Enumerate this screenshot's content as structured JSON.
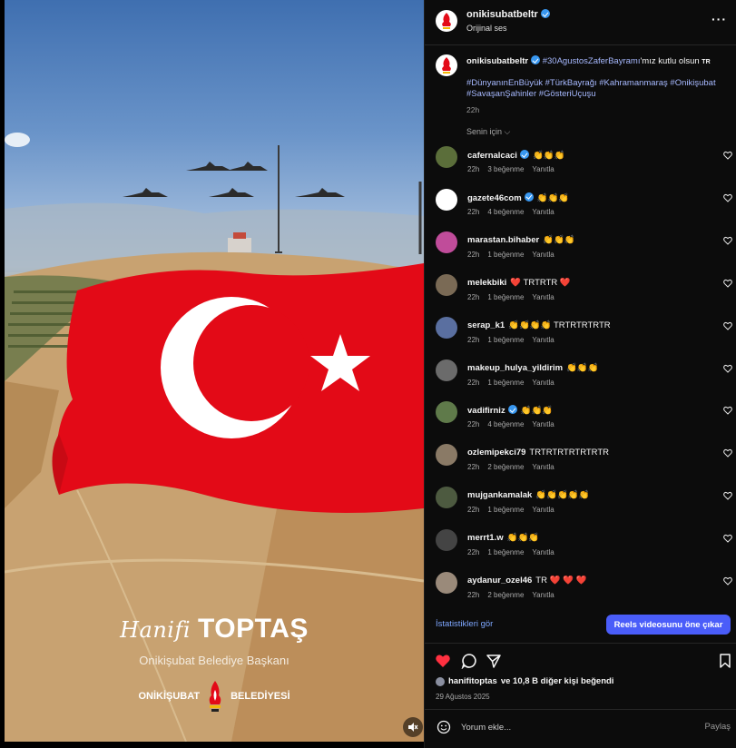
{
  "video": {
    "brand_script": "Hanifi",
    "brand_bold": "TOPTAŞ",
    "brand_title": "Onikişubat Belediye Başkanı",
    "muni_left": "ONİKİŞUBAT",
    "muni_right": "BELEDİYESİ",
    "mute_icon": "speaker-muted-icon"
  },
  "header": {
    "username": "onikisubatbeltr",
    "audio": "Orijinal ses",
    "more_icon": "more-icon"
  },
  "caption": {
    "username": "onikisubatbeltr",
    "hashtag1": "#30AgustosZaferBayramı",
    "text1": "'mız kutlu olsun",
    "flag_text": "TR",
    "tags_line1": "#DünyanınEnBüyük #TürkBayrağı #Kahramanmaraş #Onikişubat",
    "tags_line2": "#SavaşanŞahinler #GösteriUçuşu",
    "time": "22h"
  },
  "filter_label": "Senin için",
  "comments": [
    {
      "user": "cafernalcaci",
      "verified": true,
      "text": "👏👏👏",
      "time": "22h",
      "likes": "3 beğenme",
      "reply": "Yanıtla"
    },
    {
      "user": "gazete46com",
      "verified": true,
      "text": "👏👏👏",
      "time": "22h",
      "likes": "4 beğenme",
      "reply": "Yanıtla"
    },
    {
      "user": "marastan.bihaber",
      "verified": false,
      "text": "👏👏👏",
      "time": "22h",
      "likes": "1 beğenme",
      "reply": "Yanıtla"
    },
    {
      "user": "melekbiki",
      "verified": false,
      "text": "❤️ TRTRTR ❤️",
      "time": "22h",
      "likes": "1 beğenme",
      "reply": "Yanıtla"
    },
    {
      "user": "serap_k1",
      "verified": false,
      "text": "👏👏👏👏 TRTRTRTRTR",
      "time": "22h",
      "likes": "1 beğenme",
      "reply": "Yanıtla"
    },
    {
      "user": "makeup_hulya_yildirim",
      "verified": false,
      "text": "👏👏👏",
      "time": "22h",
      "likes": "1 beğenme",
      "reply": "Yanıtla"
    },
    {
      "user": "vadifirniz",
      "verified": true,
      "text": "👏👏👏",
      "time": "22h",
      "likes": "4 beğenme",
      "reply": "Yanıtla"
    },
    {
      "user": "ozlemipekci79",
      "verified": false,
      "text": "TRTRTRTRTRTRTR",
      "time": "22h",
      "likes": "2 beğenme",
      "reply": "Yanıtla"
    },
    {
      "user": "mujgankamalak",
      "verified": false,
      "text": "👏👏👏👏👏",
      "time": "22h",
      "likes": "1 beğenme",
      "reply": "Yanıtla"
    },
    {
      "user": "merrt1.w",
      "verified": false,
      "text": "👏👏👏",
      "time": "22h",
      "likes": "1 beğenme",
      "reply": "Yanıtla"
    },
    {
      "user": "aydanur_ozel46",
      "verified": false,
      "text": "TR ❤️ ❤️ ❤️",
      "time": "22h",
      "likes": "2 beğenme",
      "reply": "Yanıtla"
    }
  ],
  "stats_link": "İstatistikleri gör",
  "boost_button": "Reels videosunu öne çıkar",
  "liked_by_user": "hanifitoptas",
  "liked_by_rest": "ve 10,8 B diğer kişi beğendi",
  "date": "29 Ağustos 2025",
  "composer": {
    "placeholder": "Yorum ekle...",
    "share": "Paylaş"
  },
  "colors": {
    "panel_bg": "#0c0c0c",
    "accent_blue": "#4a5df9",
    "like_red": "#ff3040",
    "hashtag": "#a7b9ff",
    "flag_red": "#e30a17"
  }
}
